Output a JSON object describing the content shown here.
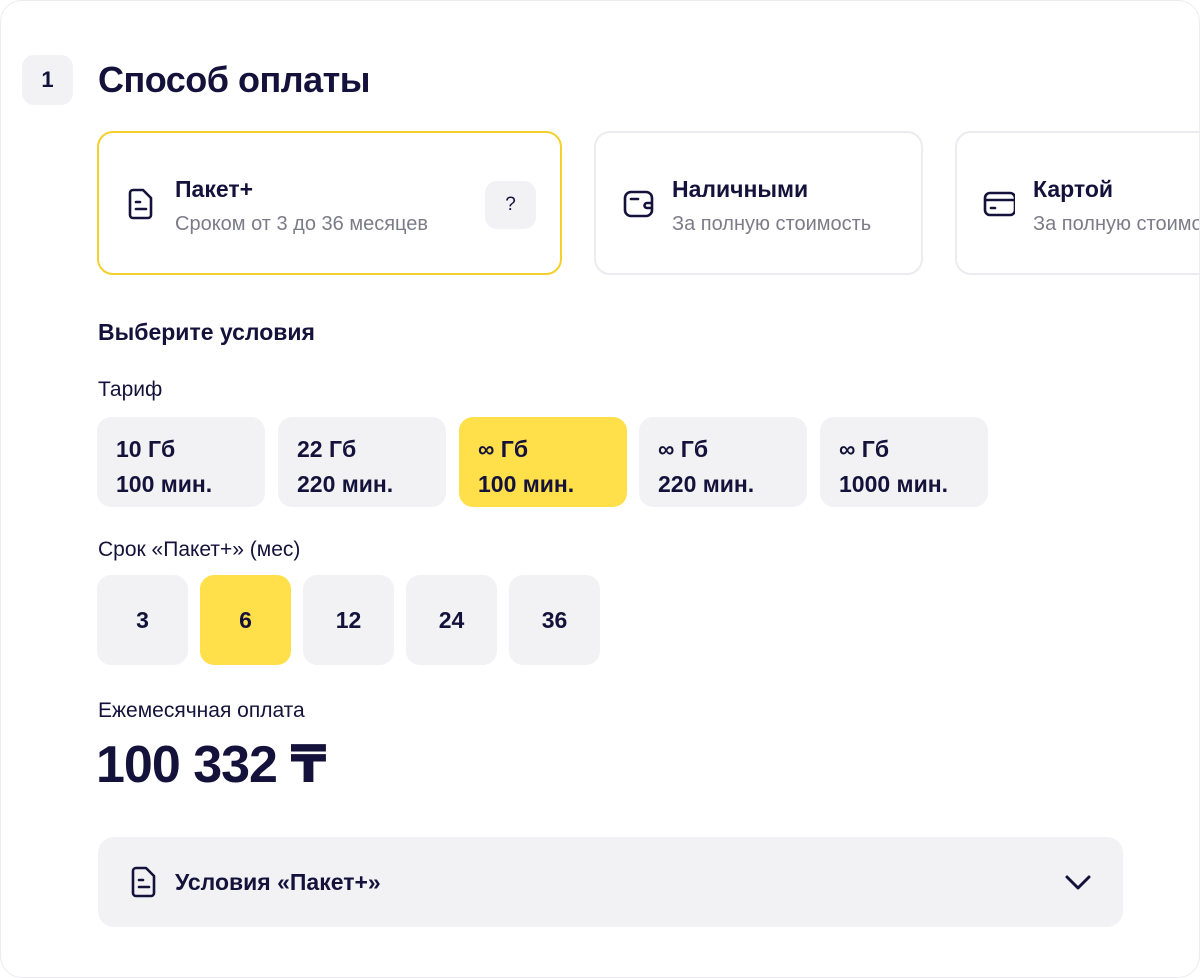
{
  "step": {
    "number": "1",
    "title": "Способ оплаты"
  },
  "payment_options": [
    {
      "title": "Пакет+",
      "subtitle": "Сроком от 3 до 36 месяцев",
      "icon": "document-icon",
      "help": "?",
      "selected": true
    },
    {
      "title": "Наличными",
      "subtitle": "За полную стоимость",
      "icon": "wallet-icon",
      "selected": false
    },
    {
      "title": "Картой",
      "subtitle": "За полную стоимость",
      "icon": "card-icon",
      "selected": false
    }
  ],
  "conditions": {
    "heading": "Выберите условия",
    "tariff_label": "Тариф",
    "tariffs": [
      {
        "data": "10 Гб",
        "minutes": "100 мин.",
        "selected": false
      },
      {
        "data": "22 Гб",
        "minutes": "220 мин.",
        "selected": false
      },
      {
        "data": "∞ Гб",
        "minutes": "100 мин.",
        "selected": true
      },
      {
        "data": "∞ Гб",
        "minutes": "220 мин.",
        "selected": false
      },
      {
        "data": "∞ Гб",
        "minutes": "1000 мин.",
        "selected": false
      }
    ],
    "term_label": "Срок «Пакет+» (мес)",
    "terms": [
      {
        "value": "3",
        "selected": false
      },
      {
        "value": "6",
        "selected": true
      },
      {
        "value": "12",
        "selected": false
      },
      {
        "value": "24",
        "selected": false
      },
      {
        "value": "36",
        "selected": false
      }
    ],
    "monthly_label": "Ежемесячная оплата",
    "monthly_price": "100 332 ₸"
  },
  "accordion": {
    "title": "Условия «Пакет+»",
    "icon": "document-icon",
    "expanded": false
  },
  "colors": {
    "accent": "#ffe04a",
    "selected_border": "#f5cf2c",
    "chip_bg": "#f2f2f5",
    "text": "#14123a",
    "muted": "#7c7c88"
  }
}
